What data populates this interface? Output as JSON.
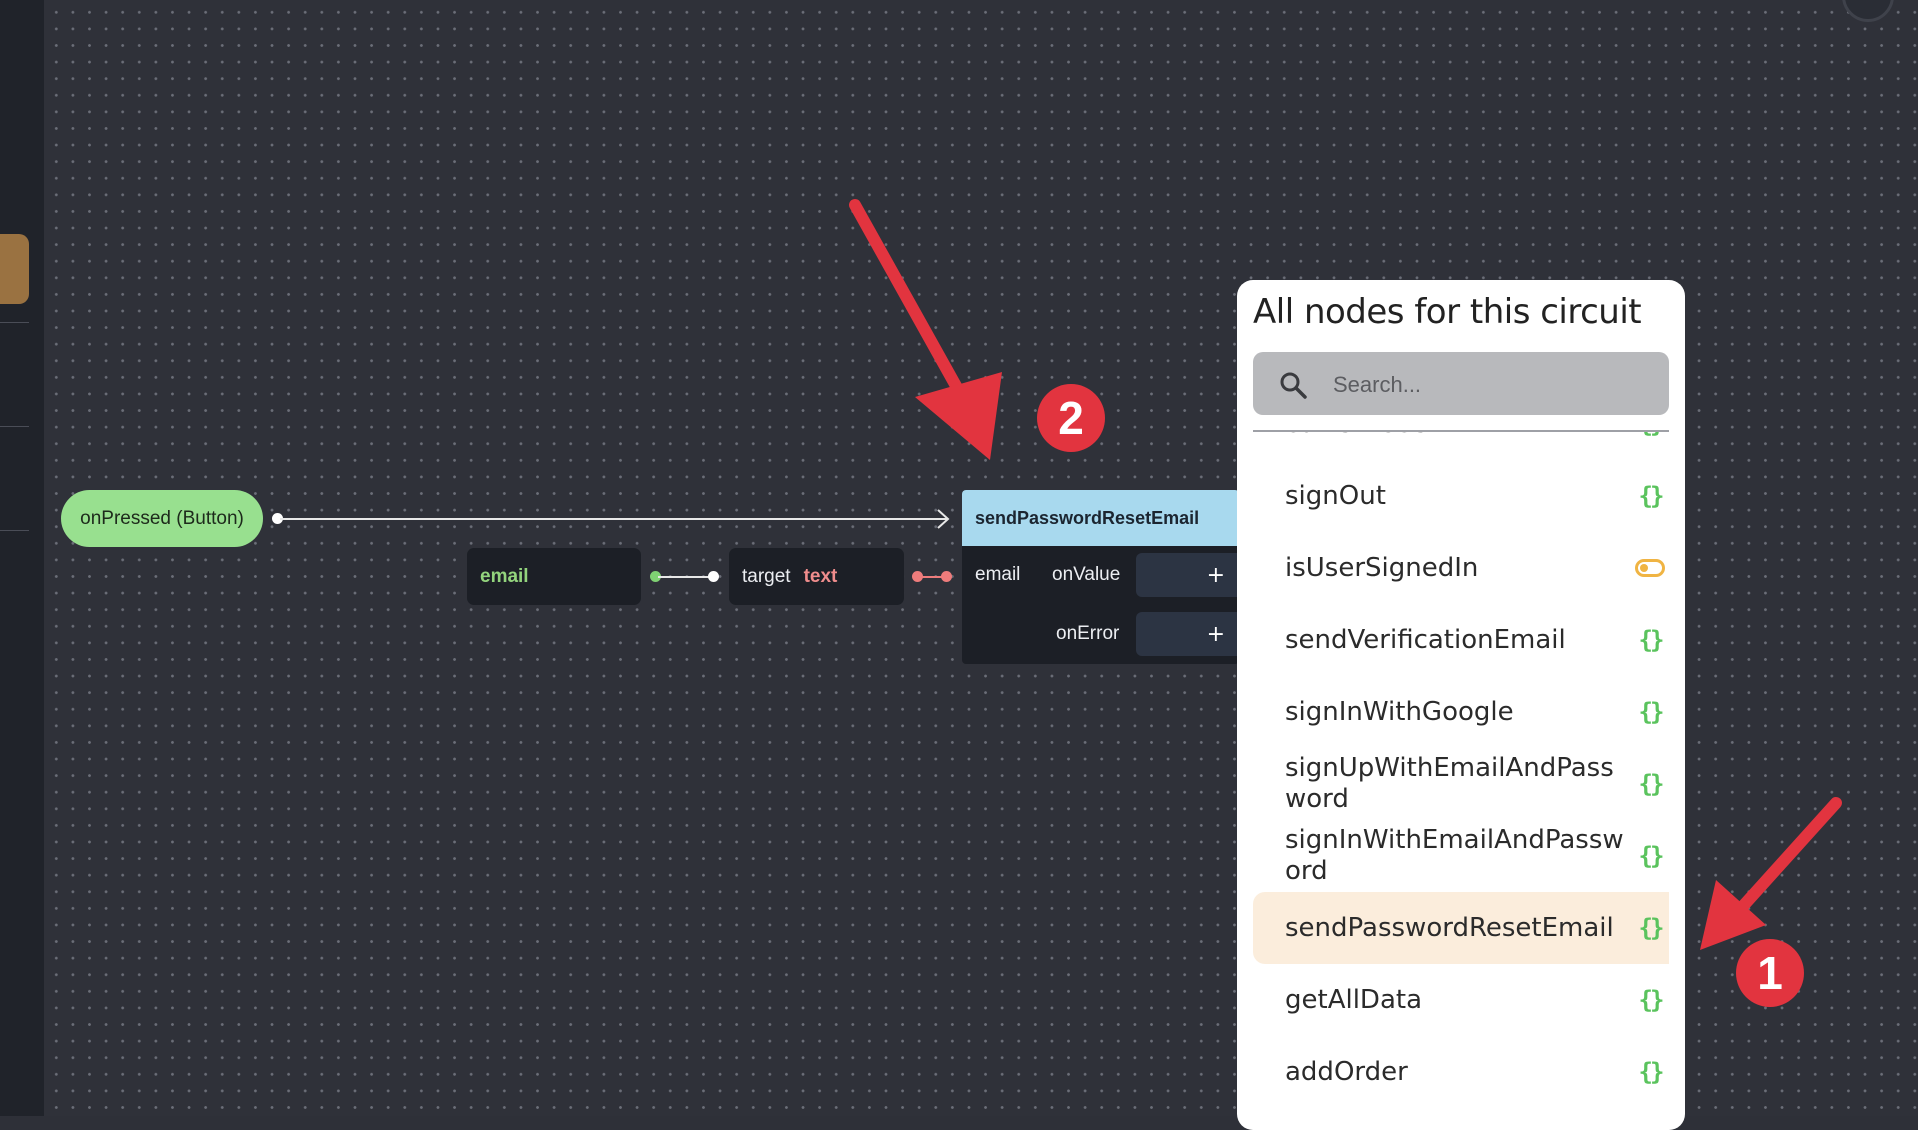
{
  "canvas": {
    "trigger_node": {
      "label": "onPressed (Button)"
    },
    "email_node": {
      "label": "email"
    },
    "target_node": {
      "label": "target",
      "value": "text"
    },
    "main_node": {
      "title": "sendPasswordResetEmail",
      "input_label": "email",
      "outputs": [
        {
          "label": "onValue",
          "add": "+"
        },
        {
          "label": "onError",
          "add": "+"
        }
      ]
    }
  },
  "panel": {
    "title": "All nodes for this circuit",
    "search_placeholder": "Search...",
    "items": [
      {
        "name": "currentUser",
        "icon": "curly-braces-icon"
      },
      {
        "name": "signOut",
        "icon": "curly-braces-icon"
      },
      {
        "name": "isUserSignedIn",
        "icon": "toggle-icon"
      },
      {
        "name": "sendVerificationEmail",
        "icon": "curly-braces-icon"
      },
      {
        "name": "signInWithGoogle",
        "icon": "curly-braces-icon"
      },
      {
        "name": "signUpWithEmailAndPassword",
        "icon": "curly-braces-icon"
      },
      {
        "name": "signInWithEmailAndPassword",
        "icon": "curly-braces-icon"
      },
      {
        "name": "sendPasswordResetEmail",
        "icon": "curly-braces-icon",
        "selected": true
      },
      {
        "name": "getAllData",
        "icon": "curly-braces-icon"
      },
      {
        "name": "addOrder",
        "icon": "curly-braces-icon"
      }
    ]
  },
  "annotations": {
    "badge_1": "1",
    "badge_2": "2"
  },
  "colors": {
    "annotation_red": "#e2343f",
    "trigger_green": "#98e08f",
    "node_header_blue": "#a8d9ee",
    "selected_item_bg": "#fbeddc",
    "icon_green": "#5ac35d"
  }
}
